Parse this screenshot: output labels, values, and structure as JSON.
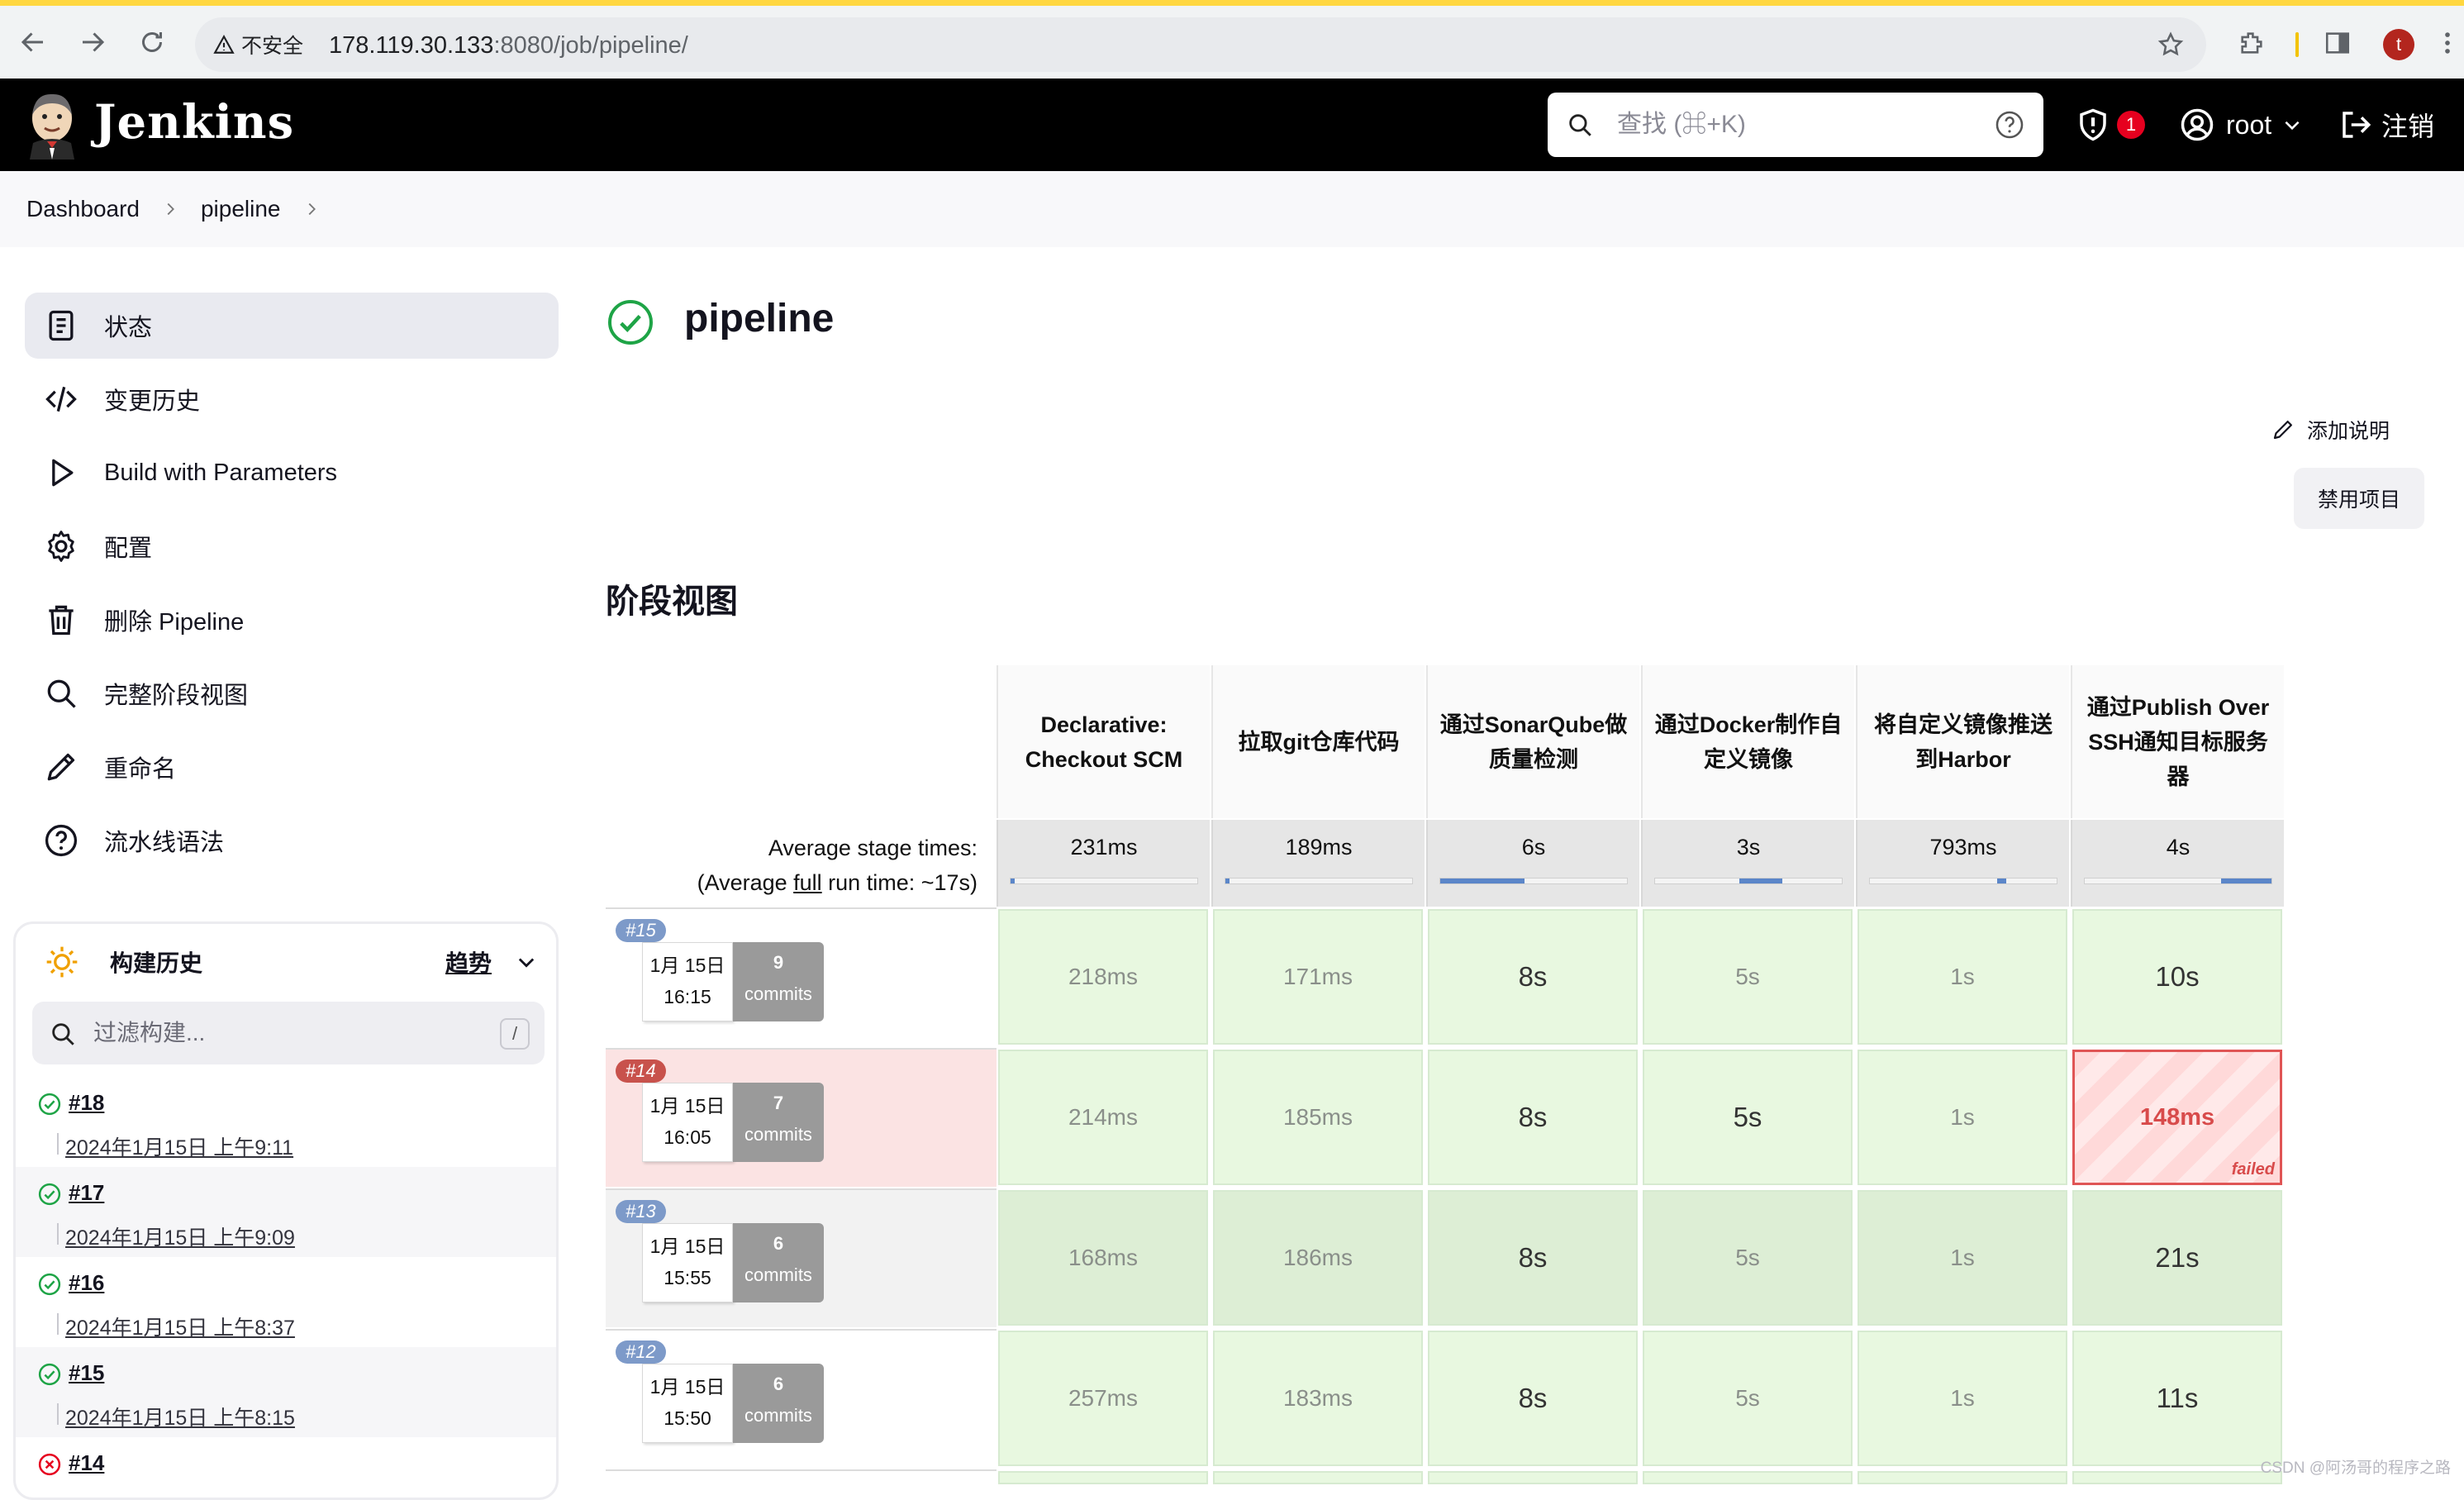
{
  "browser": {
    "security_label": "不安全",
    "url_host": "178.119.30.133",
    "url_rest": ":8080/job/pipeline/",
    "profile_initial": "t"
  },
  "header": {
    "brand": "Jenkins",
    "search_placeholder": "查找 (⌘+K)",
    "security_count": "1",
    "user": "root",
    "logout": "注销"
  },
  "breadcrumb": [
    "Dashboard",
    "pipeline"
  ],
  "sidebar": {
    "tasks": [
      {
        "label": "状态",
        "icon": "document-icon"
      },
      {
        "label": "变更历史",
        "icon": "code-icon"
      },
      {
        "label": "Build with Parameters",
        "icon": "play-icon"
      },
      {
        "label": "配置",
        "icon": "gear-icon"
      },
      {
        "label": "删除 Pipeline",
        "icon": "trash-icon"
      },
      {
        "label": "完整阶段视图",
        "icon": "search-icon"
      },
      {
        "label": "重命名",
        "icon": "pencil-icon"
      },
      {
        "label": "流水线语法",
        "icon": "help-icon"
      }
    ],
    "history": {
      "title": "构建历史",
      "trend": "趋势",
      "filter_placeholder": "过滤构建...",
      "filter_shortcut": "/",
      "builds": [
        {
          "number": "#18",
          "date": "2024年1月15日 上午9:11",
          "status": "success"
        },
        {
          "number": "#17",
          "date": "2024年1月15日 上午9:09",
          "status": "success"
        },
        {
          "number": "#16",
          "date": "2024年1月15日 上午8:37",
          "status": "success"
        },
        {
          "number": "#15",
          "date": "2024年1月15日 上午8:15",
          "status": "success"
        },
        {
          "number": "#14",
          "date": "",
          "status": "failed"
        }
      ]
    }
  },
  "main": {
    "job_name": "pipeline",
    "add_description": "添加说明",
    "disable_project": "禁用项目",
    "stage_view_title": "阶段视图",
    "avg_label_line1": "Average stage times:",
    "avg_label_pre": "(Average ",
    "avg_label_link": "full",
    "avg_label_post": " run time: ~17s)",
    "stages": [
      {
        "name": "Declarative: Checkout SCM",
        "avg": "231ms",
        "bar_start": 0.0,
        "bar_frac": 0.02
      },
      {
        "name": "拉取git仓库代码",
        "avg": "189ms",
        "bar_start": 0.0,
        "bar_frac": 0.02
      },
      {
        "name": "通过SonarQube做质量检测",
        "avg": "6s",
        "bar_start": 0.0,
        "bar_frac": 0.45
      },
      {
        "name": "通过Docker制作自定义镜像",
        "avg": "3s",
        "bar_start": 0.45,
        "bar_frac": 0.23
      },
      {
        "name": "将自定义镜像推送到Harbor",
        "avg": "793ms",
        "bar_start": 0.68,
        "bar_frac": 0.05
      },
      {
        "name": "通过Publish Over SSH通知目标服务器",
        "avg": "4s",
        "bar_start": 0.73,
        "bar_frac": 0.27
      }
    ],
    "runs": [
      {
        "badge": "#15",
        "date": "1月 15日",
        "time": "16:15",
        "commits_n": "9",
        "commits_label": "commits",
        "status": "success",
        "durations": [
          "218ms",
          "171ms",
          "8s",
          "5s",
          "1s",
          "10s"
        ]
      },
      {
        "badge": "#14",
        "date": "1月 15日",
        "time": "16:05",
        "commits_n": "7",
        "commits_label": "commits",
        "status": "failed",
        "durations": [
          "214ms",
          "185ms",
          "8s",
          "5s",
          "1s",
          "148ms"
        ],
        "failed_label": "failed"
      },
      {
        "badge": "#13",
        "date": "1月 15日",
        "time": "15:55",
        "commits_n": "6",
        "commits_label": "commits",
        "status": "success",
        "durations": [
          "168ms",
          "186ms",
          "8s",
          "5s",
          "1s",
          "21s"
        ]
      },
      {
        "badge": "#12",
        "date": "1月 15日",
        "time": "15:50",
        "commits_n": "6",
        "commits_label": "commits",
        "status": "success",
        "durations": [
          "257ms",
          "183ms",
          "8s",
          "5s",
          "1s",
          "11s"
        ]
      }
    ]
  },
  "watermark": "CSDN @阿汤哥的程序之路"
}
